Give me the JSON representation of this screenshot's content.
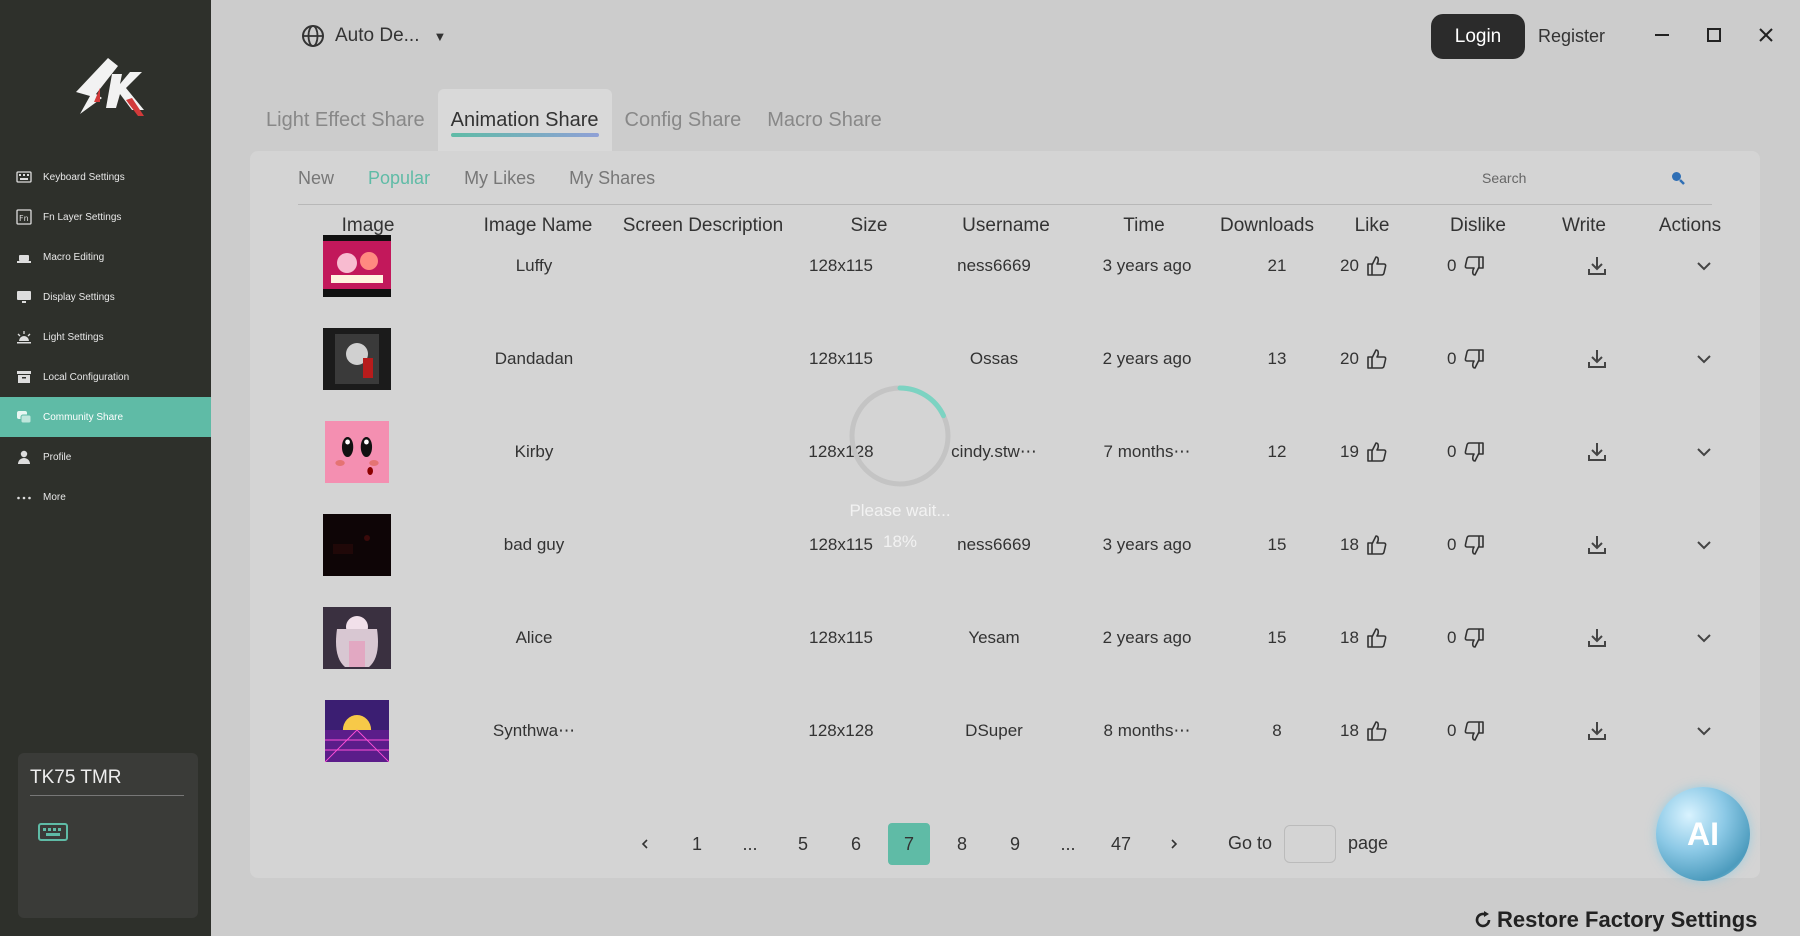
{
  "sidebar": {
    "items": [
      {
        "label": "Keyboard Settings",
        "icon": "keyboard-icon"
      },
      {
        "label": "Fn Layer Settings",
        "icon": "fn-icon"
      },
      {
        "label": "Macro Editing",
        "icon": "macro-icon"
      },
      {
        "label": "Display Settings",
        "icon": "monitor-icon"
      },
      {
        "label": "Light Settings",
        "icon": "light-icon"
      },
      {
        "label": "Local Configuration",
        "icon": "archive-icon"
      },
      {
        "label": "Community Share",
        "icon": "chat-icon"
      },
      {
        "label": "Profile",
        "icon": "person-icon"
      },
      {
        "label": "More",
        "icon": "more-icon"
      }
    ],
    "active_index": 6,
    "device": {
      "name": "TK75 TMR"
    }
  },
  "header": {
    "language": "Auto De...",
    "login_label": "Login",
    "register_label": "Register"
  },
  "main_tabs": [
    "Light Effect Share",
    "Animation Share",
    "Config Share",
    "Macro Share"
  ],
  "main_tab_active": 1,
  "sub_tabs": [
    "New",
    "Popular",
    "My Likes",
    "My Shares"
  ],
  "sub_tab_active": 1,
  "search": {
    "placeholder": "Search"
  },
  "table": {
    "columns": [
      "Image",
      "Image Name",
      "Screen Description",
      "Size",
      "Username",
      "Time",
      "Downloads",
      "Like",
      "Dislike",
      "Write",
      "Actions"
    ],
    "rows": [
      {
        "name": "Luffy",
        "description": "",
        "size": "128x115",
        "username": "ness6669",
        "time": "3 years ago",
        "downloads": "21",
        "likes": "20",
        "dislikes": "0"
      },
      {
        "name": "Dandadan",
        "description": "",
        "size": "128x115",
        "username": "Ossas",
        "time": "2 years ago",
        "downloads": "13",
        "likes": "20",
        "dislikes": "0"
      },
      {
        "name": "Kirby",
        "description": "",
        "size": "128x128",
        "username": "cindy.stw⋯",
        "time": "7 months⋯",
        "downloads": "12",
        "likes": "19",
        "dislikes": "0"
      },
      {
        "name": "bad guy",
        "description": "",
        "size": "128x115",
        "username": "ness6669",
        "time": "3 years ago",
        "downloads": "15",
        "likes": "18",
        "dislikes": "0"
      },
      {
        "name": "Alice",
        "description": "",
        "size": "128x115",
        "username": "Yesam",
        "time": "2 years ago",
        "downloads": "15",
        "likes": "18",
        "dislikes": "0"
      },
      {
        "name": "Synthwa⋯",
        "description": "",
        "size": "128x128",
        "username": "DSuper",
        "time": "8 months⋯",
        "downloads": "8",
        "likes": "18",
        "dislikes": "0"
      }
    ]
  },
  "pagination": {
    "pages": [
      "1",
      "...",
      "5",
      "6",
      "7",
      "8",
      "9",
      "...",
      "47"
    ],
    "current": "7",
    "goto_label": "Go to",
    "page_label": "page"
  },
  "loading": {
    "text": "Please wait...",
    "percent": "18%",
    "progress": 0.18
  },
  "restore_label": "Restore Factory Settings",
  "ai_label": "AI",
  "colors": {
    "accent": "#5fbba6",
    "sidebar_bg": "#2e302b",
    "page_bg": "#cccccc"
  }
}
